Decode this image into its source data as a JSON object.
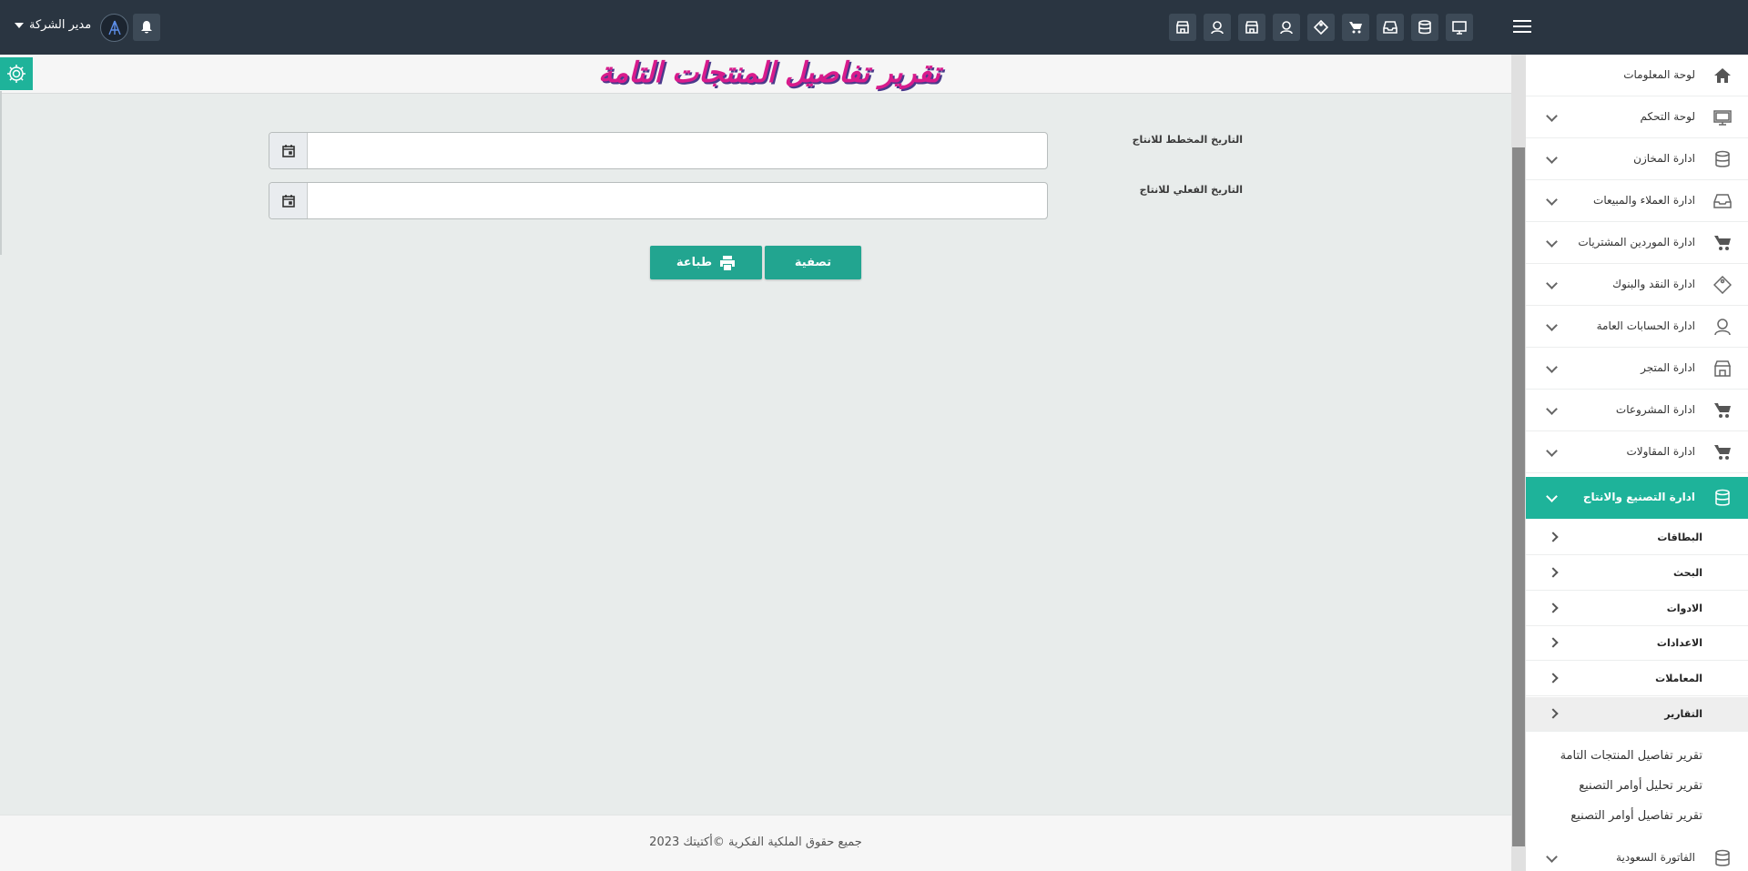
{
  "header": {
    "user_name": "مدير الشركة",
    "icons": [
      "monitor-icon",
      "database-icon",
      "inbox-icon",
      "cart-icon",
      "tag-icon",
      "user-icon",
      "store-icon",
      "user-icon",
      "store-icon"
    ]
  },
  "page": {
    "title": "تقرير تفاصيل المنتجات التامة"
  },
  "form": {
    "planned_date_label": "التاريخ المخطط للانتاج",
    "actual_date_label": "التاريخ الفعلي للانتاج",
    "planned_date_value": "",
    "actual_date_value": "",
    "filter_button": "تصفية",
    "print_button": "طباعة"
  },
  "footer": {
    "text": "جميع حقوق الملكية الفكرية ©أكتيتك 2023"
  },
  "sidebar": {
    "items": [
      {
        "label": "لوحة المعلومات",
        "icon": "home-icon"
      },
      {
        "label": "لوحة التحكم",
        "icon": "monitor-icon"
      },
      {
        "label": "ادارة المخازن",
        "icon": "database-icon"
      },
      {
        "label": "ادارة العملاء والمبيعات",
        "icon": "inbox-icon"
      },
      {
        "label": "ادارة الموردين المشتريات",
        "icon": "cart-icon"
      },
      {
        "label": "ادارة النقد والبنوك",
        "icon": "tag-icon"
      },
      {
        "label": "ادارة الحسابات العامة",
        "icon": "user-icon"
      },
      {
        "label": "ادارة المتجر",
        "icon": "store-icon"
      },
      {
        "label": "ادارة المشروعات",
        "icon": "cart-icon"
      },
      {
        "label": "ادارة المقاولات",
        "icon": "cart-icon"
      },
      {
        "label": "ادارة التصنيع والانتاج",
        "icon": "database-icon"
      }
    ],
    "sub_items": [
      "البطاقات",
      "البحث",
      "الادوات",
      "الاعدادات",
      "المعاملات",
      "التقارير"
    ],
    "report_links": [
      "تقرير تفاصيل المنتجات التامة",
      "تقرير تحليل أوامر التصنيع",
      "تقرير تفاصيل أوامر التصنيع"
    ],
    "last_item": {
      "label": "الفاتورة السعودية",
      "icon": "database-icon"
    }
  },
  "colors": {
    "topbar": "#2a3541",
    "accent": "#1eb39a",
    "button": "#22a590",
    "title": "#d81b8c"
  }
}
